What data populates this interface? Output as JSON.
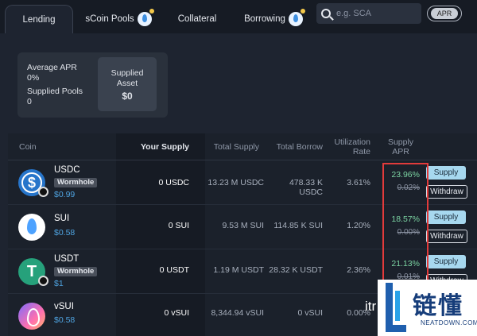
{
  "tabs": [
    {
      "label": "Lending"
    },
    {
      "label": "sCoin Pools"
    },
    {
      "label": "Collateral"
    },
    {
      "label": "Borrowing"
    }
  ],
  "search": {
    "placeholder": "e.g. SCA"
  },
  "toggle": {
    "label": "APR"
  },
  "summary": {
    "average_apr_label": "Average APR",
    "average_apr_value": "0%",
    "supplied_pools_label": "Supplied Pools",
    "supplied_pools_value": "0",
    "supplied_asset_label_1": "Supplied",
    "supplied_asset_label_2": "Asset",
    "supplied_asset_value": "$0"
  },
  "table": {
    "headers": {
      "coin": "Coin",
      "your_supply": "Your Supply",
      "total_supply": "Total Supply",
      "total_borrow": "Total Borrow",
      "util_1": "Utilization",
      "util_2": "Rate",
      "apr_1": "Supply",
      "apr_2": "APR"
    },
    "rows": [
      {
        "name": "USDC",
        "tag": "Wormhole",
        "price": "$0.99",
        "your_supply": "0 USDC",
        "total_supply": "13.23 M USDC",
        "total_borrow": "478.33 K USDC",
        "util": "3.61%",
        "apr_new": "23.96%",
        "apr_old": "0.02%",
        "supply": "Supply",
        "withdraw": "Withdraw"
      },
      {
        "name": "SUI",
        "tag": "",
        "price": "$0.58",
        "your_supply": "0 SUI",
        "total_supply": "9.53 M SUI",
        "total_borrow": "114.85 K SUI",
        "util": "1.20%",
        "apr_new": "18.57%",
        "apr_old": "0.00%",
        "supply": "Supply",
        "withdraw": "Withdraw"
      },
      {
        "name": "USDT",
        "tag": "Wormhole",
        "price": "$1",
        "your_supply": "0 USDT",
        "total_supply": "1.19 M USDT",
        "total_borrow": "28.32 K USDT",
        "util": "2.36%",
        "apr_new": "21.13%",
        "apr_old": "0.01%",
        "supply": "Supply",
        "withdraw": "Withdraw"
      },
      {
        "name": "vSUI",
        "tag": "",
        "price": "$0.58",
        "your_supply": "0 vSUI",
        "total_supply": "8,344.94 vSUI",
        "total_borrow": "0 vSUI",
        "util": "0.00%",
        "apr_new": "",
        "apr_old": "",
        "supply": "",
        "withdraw": ""
      }
    ]
  },
  "watermark": {
    "cn": "链懂",
    "en": "NEATDOWN.COM",
    "overlay_text": "itr"
  },
  "colors": {
    "accent_green": "#7bd3a2",
    "price_blue": "#4fa3e0",
    "highlight_red": "#e23b3b"
  }
}
